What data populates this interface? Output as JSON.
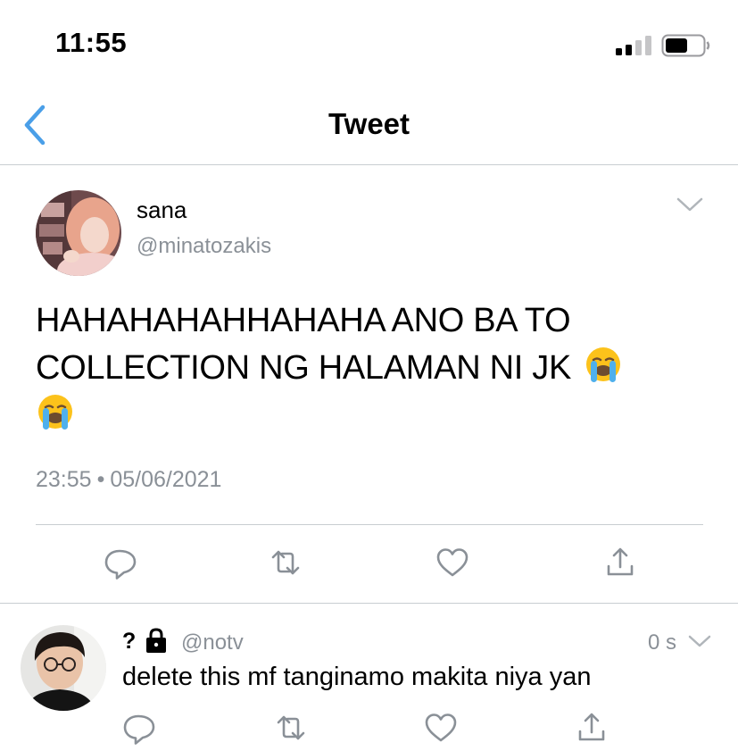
{
  "status_bar": {
    "time": "11:55",
    "icons": [
      "cellular-signal-icon",
      "battery-icon"
    ]
  },
  "nav": {
    "title": "Tweet",
    "back_icon": "chevron-left-icon",
    "accent_color": "#4a9fe8"
  },
  "tweet": {
    "author_name": "sana",
    "author_handle": "@minatozakis",
    "text_line1": "HAHAHAHAHHAHAHA ANO BA TO",
    "text_line2": "COLLECTION NG HALAMAN NI JK",
    "emoji": "loudly-crying-face",
    "time": "23:55",
    "separator": "•",
    "date": "05/06/2021",
    "actions": [
      "reply-icon",
      "retweet-icon",
      "like-icon",
      "share-icon"
    ]
  },
  "reply": {
    "author_name": "?",
    "lock_icon": "lock-icon",
    "author_handle": "@notv",
    "time_ago": "0 s",
    "text": "delete this mf tanginamo makita niya yan",
    "actions": [
      "reply-icon",
      "retweet-icon",
      "like-icon",
      "share-icon"
    ]
  },
  "colors": {
    "icon_gray": "#8a9097",
    "divider": "#c8cdd1",
    "text": "#000000"
  }
}
